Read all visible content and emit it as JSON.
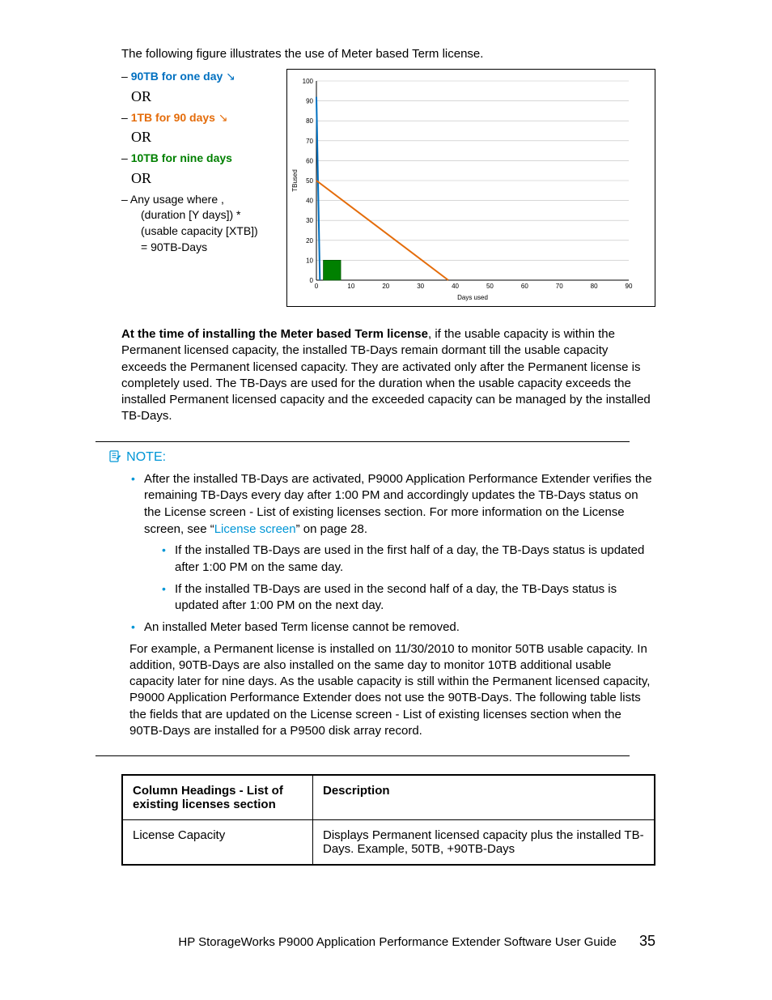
{
  "intro": "The following figure illustrates the use of Meter based Term license.",
  "legend": {
    "dash": "–",
    "item1": "90TB for one day",
    "or1": "OR",
    "item2": "1TB for 90 days",
    "or2": "OR",
    "item3": "10TB for nine days",
    "or3": "OR",
    "item4a": "Any usage where ,",
    "item4b": "(duration [Y days]) *",
    "item4c": "(usable capacity [XTB])",
    "item4d": "= 90TB-Days"
  },
  "chart_data": {
    "type": "line",
    "xlabel": "Days used",
    "ylabel": "TBused",
    "xlim": [
      0,
      90
    ],
    "ylim": [
      0,
      100
    ],
    "xticks": [
      0,
      10,
      20,
      30,
      40,
      50,
      60,
      70,
      80,
      90
    ],
    "yticks": [
      0,
      10,
      20,
      30,
      40,
      50,
      60,
      70,
      80,
      90,
      100
    ],
    "series": [
      {
        "name": "90TB for one day",
        "color": "#0070c0",
        "points": [
          [
            0,
            92
          ],
          [
            1,
            0
          ]
        ]
      },
      {
        "name": "1TB for 90 days",
        "color": "#e46c0a",
        "points": [
          [
            0,
            50
          ],
          [
            38,
            0
          ]
        ]
      },
      {
        "name": "10TB for nine days",
        "color": "#008000",
        "type": "bar",
        "x": [
          4.5
        ],
        "width": 5,
        "height": 10
      }
    ]
  },
  "main_para_bold": "At the time of installing the Meter based Term license",
  "main_para_rest": ", if the usable capacity is within the Permanent licensed capacity, the installed TB-Days remain dormant till the usable capacity exceeds the Permanent licensed capacity. They are activated only after the Permanent license is completely used. The TB-Days are used for the duration when the usable capacity exceeds the installed Permanent licensed capacity and the exceeded capacity can be managed by the installed TB-Days.",
  "note": {
    "heading": "NOTE:",
    "b1a": "After the installed TB-Days are activated, P9000 Application Performance Extender verifies the remaining TB-Days every day after 1:00 PM and accordingly updates the TB-Days status on the License screen - List of existing licenses section. For more information on the License screen, see “",
    "b1link": "License screen",
    "b1b": "” on page 28.",
    "s1": "If the installed TB-Days are used in the first half of a day, the TB-Days status is updated after 1:00 PM on the same day.",
    "s2": "If the installed TB-Days are used in the second half of a day, the TB-Days status is updated after 1:00 PM on the next day.",
    "b2": "An installed Meter based Term license cannot be removed.",
    "example": "For example, a Permanent license is installed on 11/30/2010 to monitor 50TB usable capacity. In addition, 90TB-Days are also installed on the same day to monitor 10TB additional usable capacity later for nine days. As the usable capacity is still within the Permanent licensed capacity, P9000 Application Performance Extender does not use the 90TB-Days. The following table lists the fields that are updated on the License screen - List of existing licenses section when the 90TB-Days are installed for a P9500 disk array record."
  },
  "table": {
    "h1": "Column Headings - List of existing licenses section",
    "h2": "Description",
    "r1c1": "License Capacity",
    "r1c2": "Displays Permanent licensed capacity plus the installed TB-Days. Example, 50TB, +90TB-Days"
  },
  "footer": {
    "title": "HP StorageWorks P9000 Application Performance Extender Software User Guide",
    "page": "35"
  }
}
